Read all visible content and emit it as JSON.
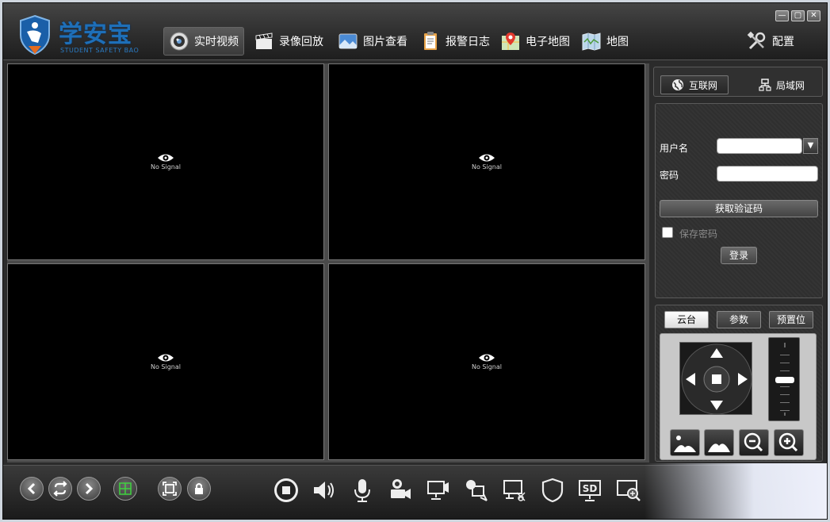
{
  "app": {
    "logo_cn": "学安宝",
    "logo_en": "STUDENT SAFETY BAO",
    "brand_color": "#1e6fb8"
  },
  "window_controls": [
    "minimize",
    "maximize",
    "close"
  ],
  "nav": {
    "tabs": [
      {
        "label": "实时视频",
        "icon": "camera-lens-icon",
        "active": true
      },
      {
        "label": "录像回放",
        "icon": "clapperboard-icon"
      },
      {
        "label": "图片查看",
        "icon": "picture-icon"
      },
      {
        "label": "报警日志",
        "icon": "clipboard-icon"
      },
      {
        "label": "电子地图",
        "icon": "map-pin-icon"
      },
      {
        "label": "地图",
        "icon": "folded-map-icon"
      }
    ],
    "settings_label": "配置"
  },
  "video": {
    "cells": [
      {
        "status": "No Signal"
      },
      {
        "status": "No Signal"
      },
      {
        "status": "No Signal"
      },
      {
        "status": "No Signal"
      }
    ]
  },
  "network": {
    "tabs": [
      {
        "label": "互联网",
        "icon": "globe-icon",
        "active": true
      },
      {
        "label": "局域网",
        "icon": "lan-icon"
      }
    ]
  },
  "login": {
    "username_label": "用户名",
    "username_value": "",
    "password_label": "密码",
    "password_value": "",
    "get_code_label": "获取验证码",
    "remember_label": "保存密码",
    "remember_checked": false,
    "login_label": "登录"
  },
  "ptz": {
    "tabs": [
      {
        "label": "云台",
        "active": true
      },
      {
        "label": "参数"
      },
      {
        "label": "预置位"
      }
    ],
    "zoom_level": 0.5
  }
}
